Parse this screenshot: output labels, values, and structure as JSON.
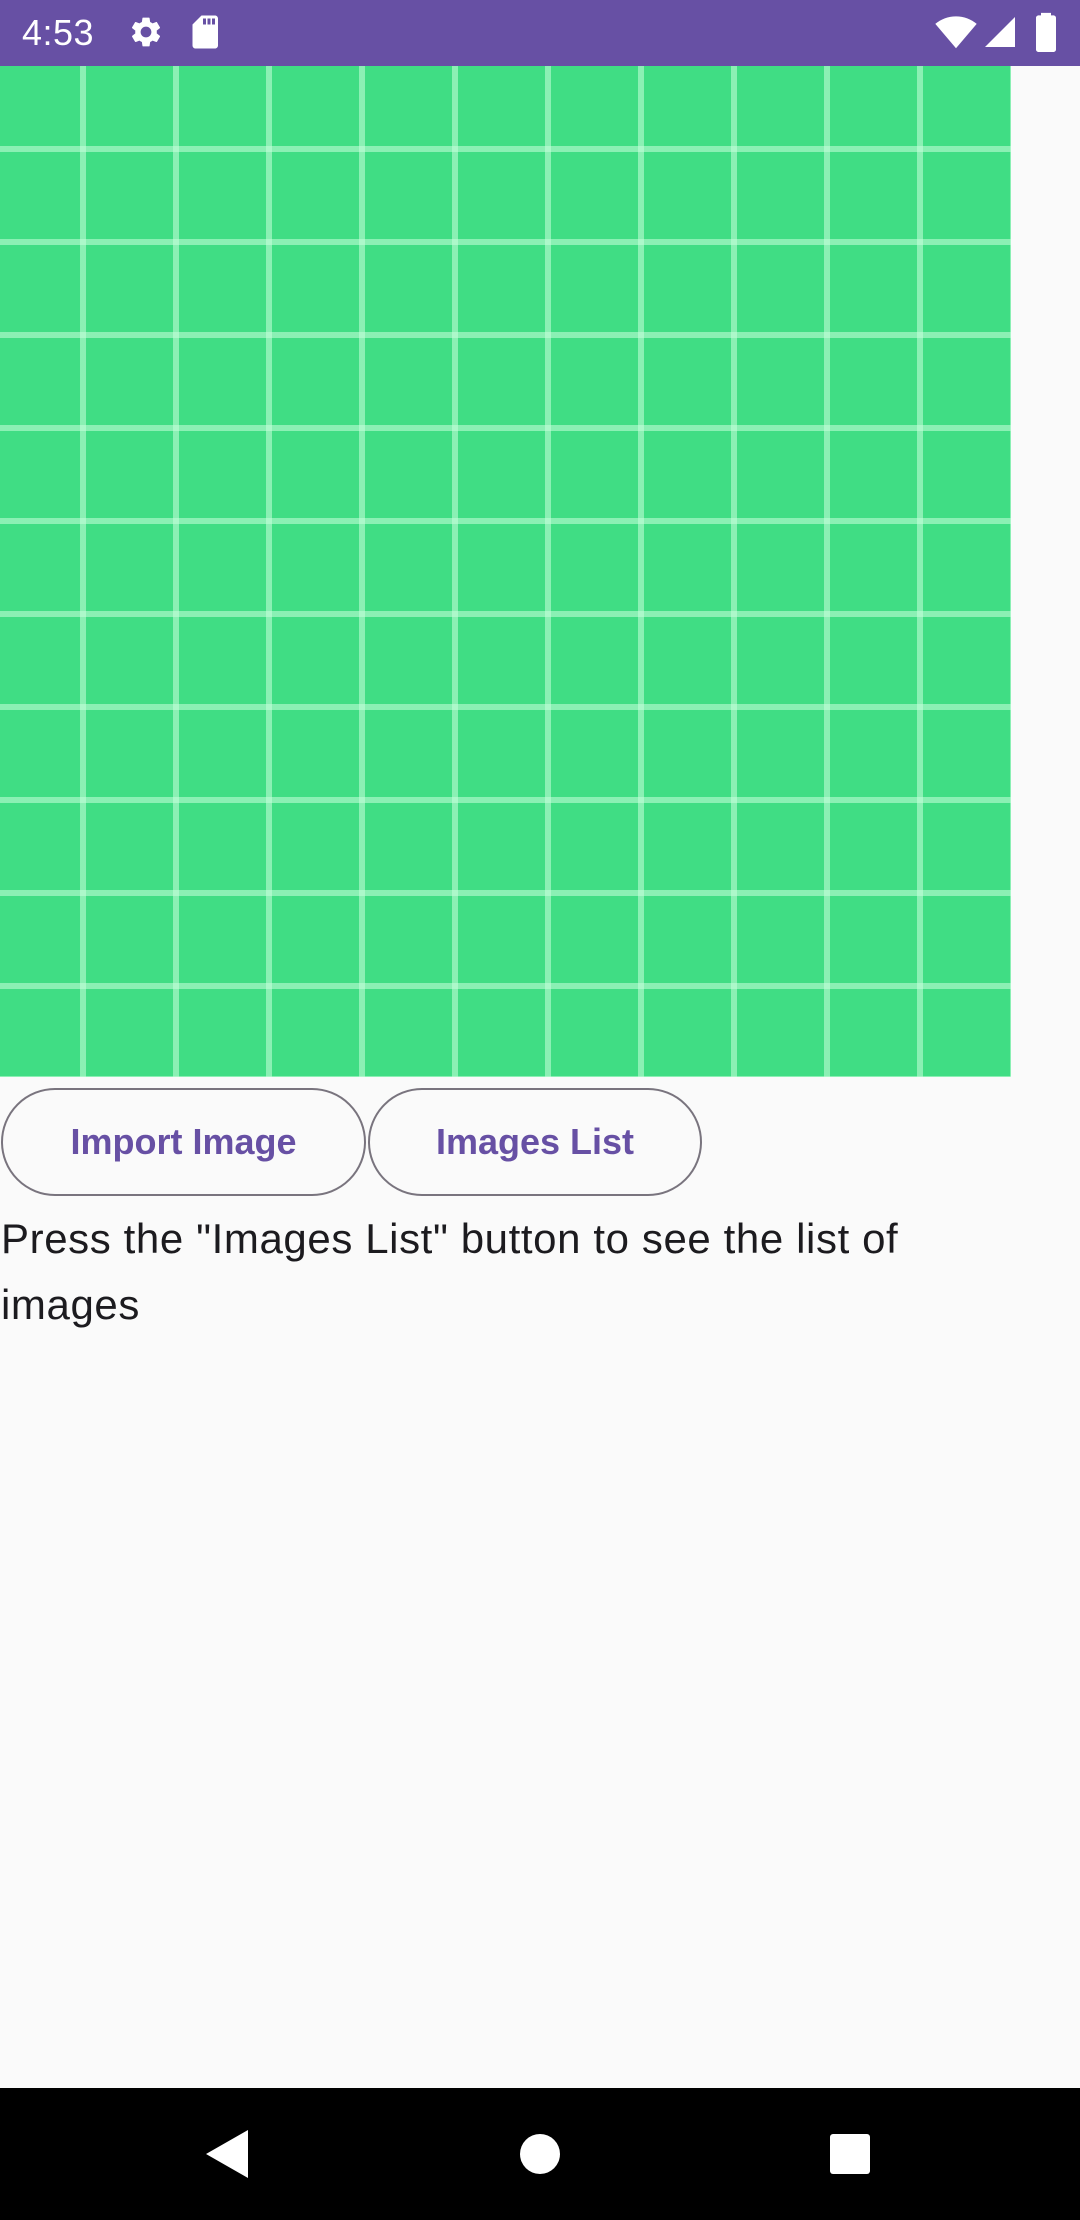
{
  "status_bar": {
    "time": "4:53",
    "icons_left": [
      "gear-icon",
      "sd-card-icon"
    ],
    "icons_right": [
      "wifi-icon",
      "cell-signal-icon",
      "battery-icon"
    ],
    "background": "#6750a4"
  },
  "image_preview": {
    "description_color": "#40dd84"
  },
  "buttons": {
    "import_label": "Import Image",
    "list_label": "Images List",
    "accent": "#6750a4"
  },
  "hint": {
    "text": "Press the \"Images List\" button to see the list of images"
  },
  "nav_bar": {
    "items": [
      "back-icon",
      "home-icon",
      "recents-icon"
    ]
  }
}
